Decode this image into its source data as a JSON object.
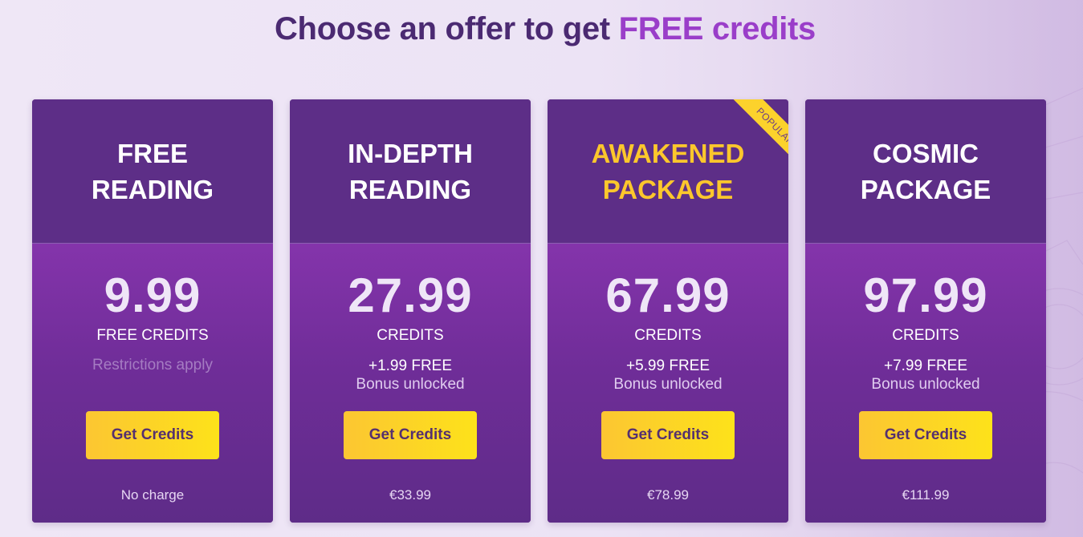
{
  "header": {
    "title_prefix": "Choose an offer to get ",
    "title_highlight": "FREE credits"
  },
  "ribbon": {
    "label": "POPULAR"
  },
  "cards": [
    {
      "title_line1": "FREE",
      "title_line2": "READING",
      "price": "9.99",
      "credits_label": "FREE CREDITS",
      "note": "Restrictions apply",
      "button": "Get Credits",
      "footer": "No charge"
    },
    {
      "title_line1": "IN-DEPTH",
      "title_line2": "READING",
      "price": "27.99",
      "credits_label": "CREDITS",
      "bonus": "+1.99 FREE",
      "bonus_note": "Bonus unlocked",
      "button": "Get Credits",
      "footer": "€33.99"
    },
    {
      "title_line1": "AWAKENED",
      "title_line2": "PACKAGE",
      "price": "67.99",
      "credits_label": "CREDITS",
      "bonus": "+5.99 FREE",
      "bonus_note": "Bonus unlocked",
      "button": "Get Credits",
      "footer": "€78.99"
    },
    {
      "title_line1": "COSMIC",
      "title_line2": "PACKAGE",
      "price": "97.99",
      "credits_label": "CREDITS",
      "bonus": "+7.99 FREE",
      "bonus_note": "Bonus unlocked",
      "button": "Get Credits",
      "footer": "€111.99"
    }
  ],
  "colors": {
    "headline": "#4b2a72",
    "highlight": "#9a3ec9",
    "card_head": "#5d2e87",
    "card_body_top": "#8434ab",
    "button": "#fcc632",
    "gold_title": "#fcc72c"
  }
}
